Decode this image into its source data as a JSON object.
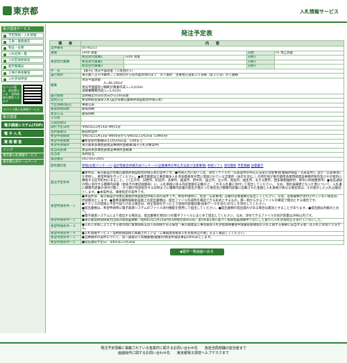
{
  "header": {
    "logo": "東京都",
    "service": "入札情報サービス"
  },
  "sidebar": {
    "section1": "電子調達サービス",
    "links1": [
      "予定情報・入札情報",
      "工事・業務委託",
      "物品・役務",
      "入札結果一覧",
      "入札監視委員会",
      "都市整備局",
      "工事の事後審査",
      "入札参加申請"
    ],
    "qr_text": "モバイル版は、東京都の入札・契約情報を閲覧できます",
    "mobile_label": "モバイル版入札情報サービス",
    "section2": "電子調達",
    "big_links": [
      "電子調達システム(TOP)",
      "電 子 入 札",
      "資 格 審 査"
    ],
    "section3": "リンク",
    "links3": [
      "東京都入札情報サービス",
      "東京都公式ホームページ"
    ]
  },
  "main": {
    "title": "発注予定表",
    "th_item": "項　　目",
    "th_content": "内　　容",
    "case_no_label": "案件番号",
    "case_no": "05-00211",
    "business_label": "業種",
    "business_value": "1400 測量",
    "category_label": "分野",
    "category_value": "01 地上測量",
    "desired_label": "希望受付業種",
    "desired": [
      {
        "label": "希望受付業種1",
        "value": "1400 測量",
        "cat_label": "分野1",
        "cat_value": ""
      },
      {
        "label": "希望受付業種2",
        "value": "",
        "cat_label": "分野2",
        "cat_value": ""
      },
      {
        "label": "希望受付業種3",
        "value": "",
        "cat_label": "分野3",
        "cat_value": ""
      }
    ],
    "name_label": "件　名",
    "name_value": "【電子】現況平面測量（５南西の２）",
    "location_label": "履行場所",
    "location_value": "東京都八王子市鶴木二丁目地内から同市越太地内まで　外５箇所　主要地方道第２０号線（第２０号）外５路線",
    "summary_label": "概要",
    "summary_lines": [
      "現況平面測量",
      "　　　　　　　A=86,200㎡",
      "現況平面図及び横断計算書作成 L=3,410m",
      "道路種種類作成 L=3,410m"
    ],
    "period_label": "履行期間",
    "period_value": "契約確定の日の翌日から100日間",
    "method_label": "契約方法",
    "method_value": "希望制指名競争入札(設計等委託業務評価型総合評価方式)",
    "price_label": "予定価格(税込)",
    "price_value": "事後公表",
    "plan_label": "最低制限価格",
    "plan_value": "最低価格",
    "dept_label": "発注方法",
    "dept_value": "最低価格",
    "other_label": "その他",
    "note_label": "公開登録日",
    "note_value": "",
    "reg_label": "開札予定日時",
    "reg_value": "令和5年12月14日 9時15分",
    "site_label": "契約着確日",
    "site_value": "紙契約案件",
    "apply_label": "希望申請期間",
    "apply_value": "令和5年11月13日 9時00分から令和5年11月20日 15時00分",
    "notice_label": "希望申請者数",
    "notice_value": "●希望受付業種日(11月20日)は、15時まで",
    "win_label": "希望申請場所",
    "win_value": "東京都南多摩西部建設事務所直轄課(電子入札対象案件)",
    "dep2_label": "担当局部課",
    "dep2_value": "建設局南多摩西部建設事務所直轄課",
    "person_label": "担当者",
    "person_value": "契約担当",
    "tel_label": "電話番号",
    "tel_value": "042-643-2605",
    "dist_label": "配布資料等",
    "dist_files": [
      "参照(お客パッケージ)",
      "設計等総合評価方式パッケージ(企業事件の申込方法及び注意事項)",
      "手続ソフト",
      "添付資料",
      "予定価格",
      "注意書き"
    ],
    "cond_label": "発注予定条件",
    "cond_text": "●本件は、東京都設計等委託業務評価型総合評価方式の案件です。●申請入力においては、添付ファイルの「公表案件の申込方法及び注意事項(業績評価型・公表案件)」及び「公表事項」を参照し、希望申請を行ってください。●東京都建設工事等競争入札参加資格受付票に登録されている営業所（本店を含む。）の所在地が東京都南多摩西部建設事務所管内及びその管内に隣接する区市町村にあること。（八王子市、日野市、町田市、多摩市、稲城市、府中市、国立市、立川市、昭島市、福生市、あきる野市、西多摩郡檜原村、神奈川県相模原市）●指名通知の際に添付する積算内訳書（金抜きの委託総額表）に、入札価格に係る内訳金額を記載の上、これを入札書に添付して提出してください。　なお、落札候補者となった者について、入札書に積算内訳書の添付が無く、かつ都が別途指示する日時までに積算内訳書の提出が無かった場合及び積算内訳書に記載された金額と入札価格が異なる場合等は、その者のした入札は無効とします。●本案件は、価格指定の案件です。",
    "req_label1": "希望申請条件－１",
    "req_text1": "●本案件は、東京都設計等委託業務評価型総合評価方式の案件です。希望申請時に、別添「公表事項」記載の必要書類を提出してください。なお、必要書類が添付されていない場合は、原則無効とします。●業務実績情報検索画面上の提出書類は、提出ファイル作成時を確認できる形式とするもの。都－側からからファイルの確認で無効とする場合です。",
    "req_text1b": "●テクリスの登録に不足や誤りがある場合は、修正登録を行った上で登録内容確認書(技術データを含む)の写しを添付してください。",
    "req_text1c": "●提出書類は、希望申請時に電子調達システムのファイル添付機能を使用して提出してください。●提出書類の提出漏れがある場合は無効とすることがあります。●提出順は別紙のとおり。",
    "req_text1d": "●電子調達システムにより提出する場合は、提出書類を原則1つの電子ファイルにまとめて提出してください。なお、添付できるファイルの合計容量は2MB以内です。",
    "req_label2": "希望申請条件－２",
    "req_text2": "●東京都契約関係暴力団等対策措置要綱（昭和62年1月14日付61財経庶第922号）第5条第1項に基づく排除措置期間中でないこと並びに入札参加停止を受けていないこと。",
    "req_label3": "希望申請条件－３",
    "req_text3": "●入札に参加しようとする者の間に資本関係又は人的関係がある場合（東京都建設工事等競争入札参加資格審査申請書取扱規程の入札に関する要綱に該当する者）は入札に参加できません。",
    "req_label4": "希望申請条件－４",
    "req_text4": "●入札情報サービス・契約制限関係に掲載されている「工事調達等競争入札参加停止の者」をよく確認してください。",
    "req_label5": "希望申請条件－５",
    "req_text5": "●当事務所の案件について、同一調達日で同種業種(業種)の希望申請は事前1件のみとします。",
    "req_label6": "希望申請条件－６",
    "req_text6": "●指名通知予定日：令和5年11月28日",
    "back_button": "◆案件一覧画面へ戻る"
  },
  "footer": {
    "line1": "発注予定情報に掲載されている各案件に関するお問い合わせ先　　各担当局部課の担当者まで",
    "line2": "画面操作に関するお問い合わせ先　　東京都電子調達ヘルプデスクまで"
  },
  "colors": {
    "accent": "#2e7d32",
    "label_bg": "#d9ead9"
  }
}
